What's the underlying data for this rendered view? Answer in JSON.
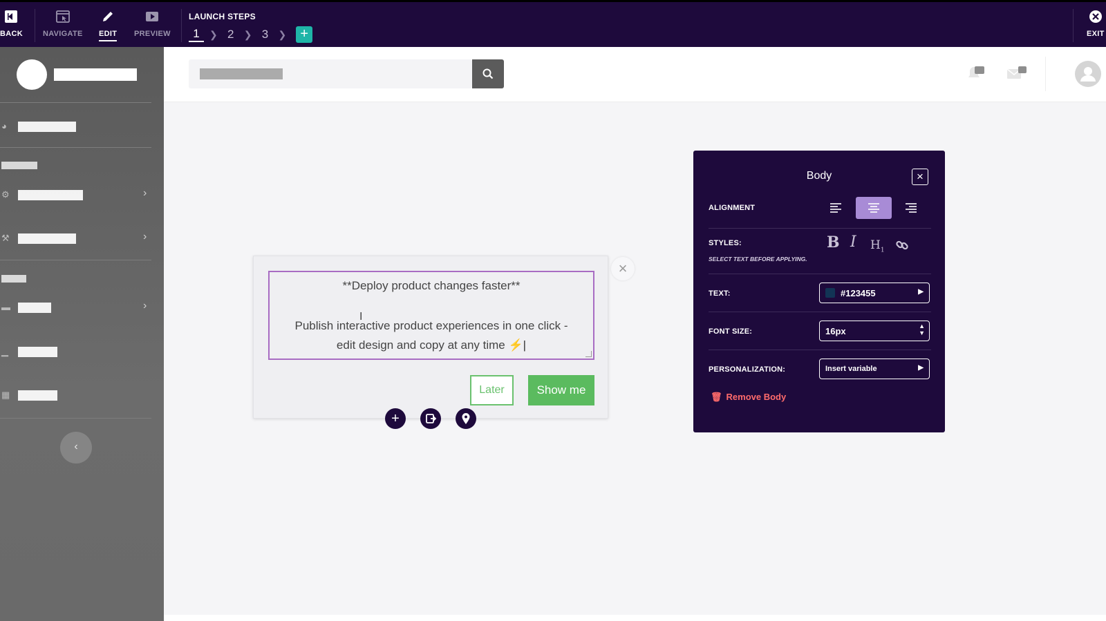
{
  "topbar": {
    "back_label": "BACK",
    "navigate_label": "NAVIGATE",
    "edit_label": "EDIT",
    "preview_label": "PREVIEW",
    "launch_title": "LAUNCH STEPS",
    "steps": [
      "1",
      "2",
      "3"
    ],
    "add_step": "+",
    "exit_label": "EXIT"
  },
  "modal": {
    "heading": "**Deploy product changes faster**",
    "body_line1": "Publish interactive product experiences in one click -",
    "body_line2": "edit design and copy at any time ⚡",
    "later_label": "Later",
    "show_me_label": "Show me"
  },
  "panel": {
    "title": "Body",
    "alignment_label": "ALIGNMENT",
    "styles_label": "STYLES:",
    "styles_hint": "SELECT TEXT BEFORE APPLYING.",
    "text_label": "TEXT:",
    "text_color_value": "#123455",
    "font_size_label": "FONT SIZE:",
    "font_size_value": "16px",
    "personalization_label": "PERSONALIZATION:",
    "personalization_value": "Insert variable",
    "remove_label": "Remove Body",
    "alignment_selected": "center"
  },
  "colors": {
    "topbar_bg": "#1e0a3c",
    "accent_purple": "#a86cc3",
    "button_green": "#5bbb5f",
    "add_step_teal": "#1fb5a8",
    "remove_red": "#ff6b6b"
  }
}
